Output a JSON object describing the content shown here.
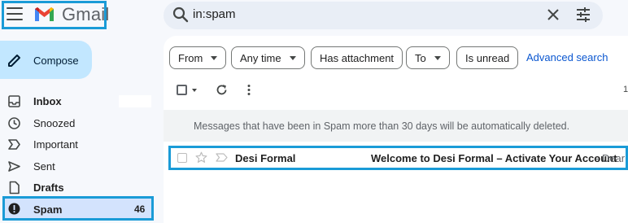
{
  "header": {
    "app_name": "Gmail",
    "menu_icon": "hamburger-menu-icon",
    "search": {
      "value": "in:spam",
      "icons": [
        "search-icon",
        "close-icon",
        "tune-icon"
      ]
    }
  },
  "colors": {
    "highlight_border": "#1a9bd7",
    "compose_bg": "#c2e7ff",
    "selected_nav_bg": "#d3e3fd",
    "link": "#0b57d0"
  },
  "compose": {
    "label": "Compose",
    "icon": "pencil-icon"
  },
  "sidebar": {
    "items": [
      {
        "label": "Inbox",
        "icon": "inbox-icon",
        "bold": true
      },
      {
        "label": "Snoozed",
        "icon": "clock-icon",
        "bold": false
      },
      {
        "label": "Important",
        "icon": "important-icon",
        "bold": false
      },
      {
        "label": "Sent",
        "icon": "send-icon",
        "bold": false
      },
      {
        "label": "Drafts",
        "icon": "draft-icon",
        "bold": true
      },
      {
        "label": "Spam",
        "icon": "spam-icon",
        "bold": true,
        "count": "46",
        "selected": true
      }
    ]
  },
  "filters": {
    "chips": [
      "From",
      "Any time",
      "Has attachment",
      "To",
      "Is unread"
    ],
    "advanced_search": "Advanced search"
  },
  "toolbar": {
    "page_indicator": "1"
  },
  "banner": {
    "text": "Messages that have been in Spam more than 30 days will be automatically deleted."
  },
  "emails": [
    {
      "sender": "Desi Formal",
      "subject": "Welcome to Desi Formal – Activate Your Account",
      "snippet": " - Dear"
    }
  ]
}
